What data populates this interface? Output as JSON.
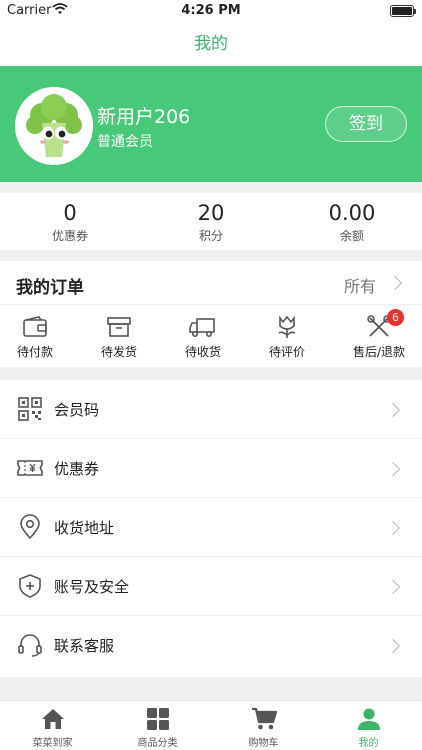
{
  "status_bar": {
    "carrier": "Carrier",
    "time": "4:26 PM"
  },
  "nav": {
    "title": "我的"
  },
  "profile": {
    "username": "新用户206",
    "level": "普通会员",
    "signin_label": "签到"
  },
  "stats": [
    {
      "value": "0",
      "label": "优惠券"
    },
    {
      "value": "20",
      "label": "积分"
    },
    {
      "value": "0.00",
      "label": "余额"
    }
  ],
  "orders": {
    "title": "我的订单",
    "all_label": "所有",
    "items": [
      {
        "label": "待付款",
        "icon": "wallet-icon"
      },
      {
        "label": "待发货",
        "icon": "box-icon"
      },
      {
        "label": "待收货",
        "icon": "truck-icon"
      },
      {
        "label": "待评价",
        "icon": "flower-icon"
      },
      {
        "label": "售后/退款",
        "icon": "tools-icon",
        "badge": "6"
      }
    ]
  },
  "menu": [
    {
      "label": "会员码",
      "icon": "qrcode-icon"
    },
    {
      "label": "优惠券",
      "icon": "coupon-icon"
    },
    {
      "label": "收货地址",
      "icon": "location-icon"
    },
    {
      "label": "账号及安全",
      "icon": "shield-icon"
    },
    {
      "label": "联系客服",
      "icon": "headset-icon"
    }
  ],
  "tabbar": [
    {
      "label": "菜菜到家",
      "icon": "home-icon"
    },
    {
      "label": "商品分类",
      "icon": "grid-icon"
    },
    {
      "label": "购物车",
      "icon": "cart-icon"
    },
    {
      "label": "我的",
      "icon": "user-icon",
      "active": true
    }
  ],
  "colors": {
    "brand_green": "#48c97a",
    "active_tab": "#3cb56b",
    "badge_red": "#e8322d"
  }
}
